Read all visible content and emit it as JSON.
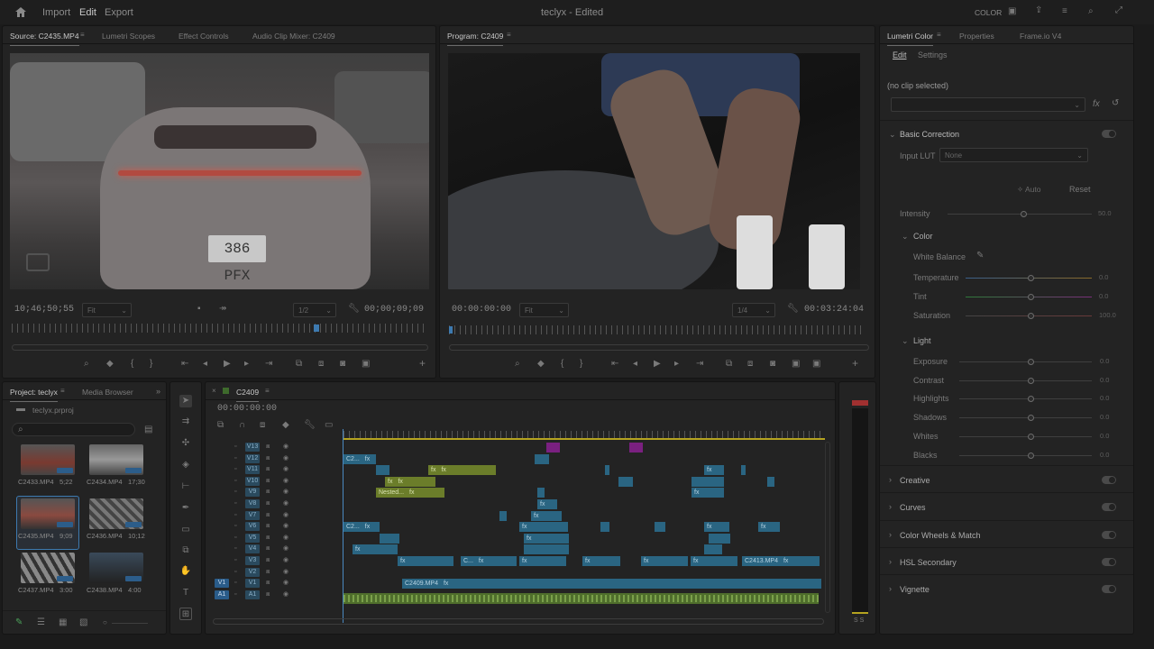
{
  "menu": {
    "import": "Import",
    "edit": "Edit",
    "export": "Export",
    "title": "teclyx - Edited",
    "color_mode": "COLOR"
  },
  "source": {
    "tabs": [
      "Source: C2435.MP4",
      "Lumetri Scopes",
      "Effect Controls",
      "Audio Clip Mixer: C2409"
    ],
    "timecode_left": "10;46;50;55",
    "fit": "Fit",
    "res": "1/2",
    "timecode_right": "00;00;09;09",
    "plate": "386 PFX"
  },
  "program": {
    "tab": "Program: C2409",
    "timecode_left": "00:00:00:00",
    "fit": "Fit",
    "res": "1/4",
    "timecode_right": "00:03:24:04"
  },
  "lumetri": {
    "tabs": [
      "Lumetri Color",
      "Properties",
      "Frame.io V4"
    ],
    "subtabs": [
      "Edit",
      "Settings"
    ],
    "no_clip": "(no clip selected)",
    "basic": "Basic Correction",
    "input_lut": "Input LUT",
    "lut_value": "None",
    "auto": "Auto",
    "reset": "Reset",
    "intensity": "Intensity",
    "intensity_val": "50.0",
    "color": "Color",
    "white_balance": "White Balance",
    "color_rows": [
      {
        "label": "Temperature",
        "val": "0.0"
      },
      {
        "label": "Tint",
        "val": "0.0"
      },
      {
        "label": "Saturation",
        "val": "100.0"
      }
    ],
    "light": "Light",
    "light_rows": [
      {
        "label": "Exposure",
        "val": "0.0"
      },
      {
        "label": "Contrast",
        "val": "0.0"
      },
      {
        "label": "Highlights",
        "val": "0.0"
      },
      {
        "label": "Shadows",
        "val": "0.0"
      },
      {
        "label": "Whites",
        "val": "0.0"
      },
      {
        "label": "Blacks",
        "val": "0.0"
      }
    ],
    "sections": [
      "Creative",
      "Curves",
      "Color Wheels & Match",
      "HSL Secondary",
      "Vignette"
    ]
  },
  "project": {
    "tabs": [
      "Project: teclyx",
      "Media Browser"
    ],
    "file": "teclyx.prproj",
    "items": [
      {
        "name": "C2433.MP4",
        "dur": "5;22"
      },
      {
        "name": "C2434.MP4",
        "dur": "17;30"
      },
      {
        "name": "C2435.MP4",
        "dur": "9;09"
      },
      {
        "name": "C2436.MP4",
        "dur": "10;12"
      },
      {
        "name": "C2437.MP4",
        "dur": "3:00"
      },
      {
        "name": "C2438.MP4",
        "dur": "4:00"
      }
    ]
  },
  "timeline": {
    "seq": "C2409",
    "timecode": "00:00:00:00",
    "tracks": [
      "V13",
      "V12",
      "V11",
      "V10",
      "V9",
      "V8",
      "V7",
      "V6",
      "V5",
      "V4",
      "V3",
      "V2",
      "V1",
      "A1"
    ],
    "clip_labels": {
      "nested": "Nested...",
      "c2": "C2...",
      "c": "C...",
      "c2413": "C2413.MP4",
      "c2409": "C2409.MP4",
      "fx": "fx"
    },
    "vu": "S S"
  }
}
